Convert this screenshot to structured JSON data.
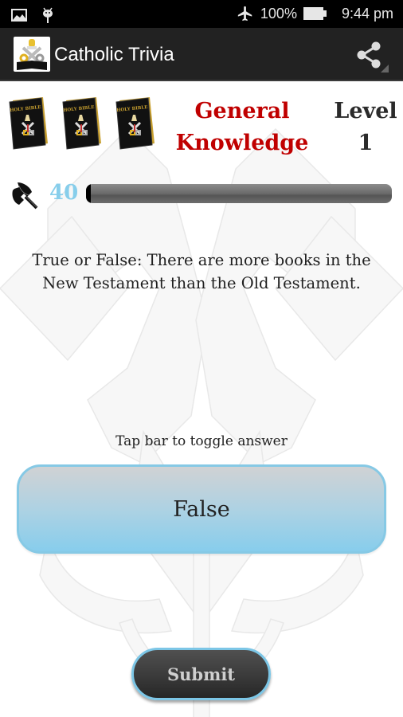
{
  "status_bar": {
    "battery_percent": "100%",
    "time": "9:44 pm",
    "icons": [
      "image-icon",
      "android-icon",
      "airplane-mode-icon",
      "battery-icon"
    ]
  },
  "action_bar": {
    "title": "Catholic Trivia",
    "share_icon": "share-icon"
  },
  "game": {
    "lives_icon": "holy-bible-icon",
    "lives": 3,
    "bible_label": "HOLY BIBLE",
    "category_line1": "General",
    "category_line2": "Knowledge",
    "level_label": "Level",
    "level_value": "1",
    "score_icon": "battle-axe-icon",
    "score": "40",
    "progress_fraction": 0.01
  },
  "question": {
    "text": "True or False: There are more books in the New Testament than the Old Testament."
  },
  "answer": {
    "hint": "Tap bar to toggle answer",
    "current_value": "False"
  },
  "submit_label": "Submit",
  "colors": {
    "category": "#c00000",
    "score": "#87ceeb",
    "answer_border": "#86c9e5",
    "action_bar": "#222222"
  }
}
